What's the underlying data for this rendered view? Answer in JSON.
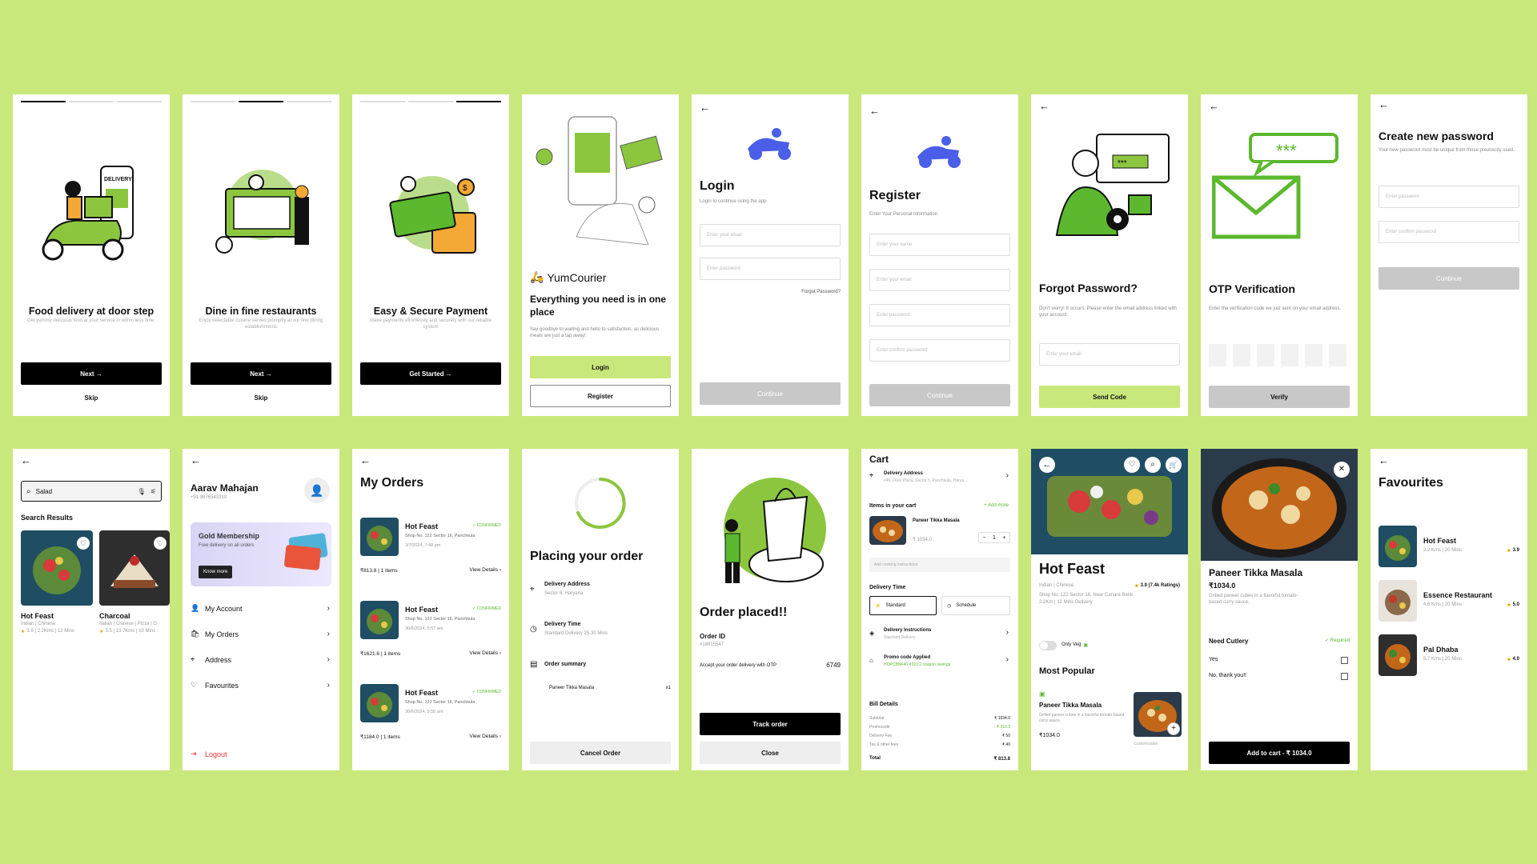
{
  "s1": {
    "title": "Food delivery at door step",
    "subtitle": "Get yummy delicious food at your service in within less time.",
    "btn": "Next →",
    "skip": "Skip",
    "delivery_sign": "DELIVERY"
  },
  "s2": {
    "title": "Dine in fine restaurants",
    "subtitle": "Enjoy delectable cuisine served promptly at our fine dining establishments",
    "btn": "Next →",
    "skip": "Skip"
  },
  "s3": {
    "title": "Easy & Secure Payment",
    "subtitle": "Make payments effortlessly and securely with our reliable system",
    "btn": "Get Started →"
  },
  "s4": {
    "brand": "YumCourier",
    "title": "Everything you need is in one place",
    "subtitle": "Say goodbye to waiting and hello to satisfaction, as delicious meals are just a tap away!",
    "login": "Login",
    "register": "Register"
  },
  "s5": {
    "title": "Login",
    "subtitle": "Login to continue using the app",
    "email_ph": "Enter your email",
    "pass_ph": "Enter password",
    "forgot": "Forgot Password?",
    "btn": "Continue"
  },
  "s6": {
    "title": "Register",
    "subtitle": "Enter Your Personal Information",
    "name_ph": "Enter your name",
    "email_ph": "Enter your email",
    "pass_ph": "Enter password",
    "confirm_ph": "Enter confirm password",
    "btn": "Continue"
  },
  "s7": {
    "title": "Forgot Password?",
    "subtitle": "Don't worry! It occurs. Please enter the email address linked with your account.",
    "email_ph": "Enter your email",
    "btn": "Send Code",
    "bubble_text": "***"
  },
  "s8": {
    "title": "OTP Verification",
    "subtitle": "Enter the verification code we just sent on your email address.",
    "btn": "Verify",
    "bubble_text": "***"
  },
  "s9": {
    "title": "Create new password",
    "subtitle": "Your new password must be unique from those previously used.",
    "pass_ph": "Enter password",
    "confirm_ph": "Enter confirm password",
    "btn": "Continue"
  },
  "s10": {
    "search_value": "Salad",
    "section": "Search Results",
    "results": [
      {
        "name": "Hot Feast",
        "meta": "Indian | Chinese",
        "rating": "3.9 | 2.2Kms | 12 Mins"
      },
      {
        "name": "Charcoal",
        "meta": "Italian | Chinese | Pizza | G",
        "rating": "3.5 | 13.7Kms | 10 Mins"
      }
    ]
  },
  "s11": {
    "name": "Aarav Mahajan",
    "phone": "+91 9876543210",
    "card_title": "Gold Membership",
    "card_sub": "Free delivery on all orders",
    "card_btn": "Know more",
    "menu": [
      "My Account",
      "My Orders",
      "Address",
      "Favourites"
    ],
    "logout": "Logout"
  },
  "s12": {
    "title": "My Orders",
    "orders": [
      {
        "name": "Hot Feast",
        "status": "CONFIRMED",
        "addr": "Shop No. 122 Sector 16, Panchkula",
        "date": "3/7/2024, 7:48 pm",
        "price": "₹813.8 | 1 items",
        "link": "View Details"
      },
      {
        "name": "Hot Feast",
        "status": "CONFIRMED",
        "addr": "Shop No. 122 Sector 16, Panchkula",
        "date": "30/6/2024, 5:57 am",
        "price": "₹1621.6 | 1 items",
        "link": "View Details"
      },
      {
        "name": "Hot Feast",
        "status": "CONFIRMED",
        "addr": "Shop No. 122 Sector 16, Panchkula",
        "date": "30/6/2024, 5:55 am",
        "price": "₹1184.0 | 1 items",
        "link": "View Details"
      }
    ]
  },
  "s13": {
    "title": "Placing your order",
    "addr_label": "Delivery Address",
    "addr_value": "Sector 6, Haryana",
    "time_label": "Delivery Time",
    "time_value": "Standard Delivery 25-30 Mins",
    "summary_label": "Order summary",
    "item": "Paneer Tikka Masala",
    "qty": "x1",
    "btn": "Cancel Order"
  },
  "s14": {
    "title": "Order placed!!",
    "id_label": "Order ID",
    "id_value": "#18915547",
    "otp_label": "Accept your order delivery with OTP",
    "otp_value": "6749",
    "track": "Track order",
    "close": "Close"
  },
  "s15": {
    "title": "Cart",
    "addr_label": "Delivery Address",
    "addr_value": "#46, Floor Plaza, Sector 5, Panchkula, Harya...",
    "items_label": "Items in your cart",
    "add_more": "+ Add more",
    "item_name": "Paneer Tikka Masala",
    "item_price": "₹ 1034.0",
    "qty": "1",
    "instr_ph": "Add cooking instructions",
    "time_label": "Delivery Time",
    "standard": "Standard",
    "schedule": "Schedule",
    "instr_label": "Delivery Instructions",
    "instr_value": "Standard Delivery",
    "promo_label": "Promo code Applied",
    "promo_value": "HOPCBNF40  ₹310.2 coupon savings",
    "bill_title": "Bill Details",
    "bill": [
      {
        "k": "Subtotal",
        "v": "₹ 1034.0"
      },
      {
        "k": "Promocode",
        "v": "- ₹ 310.2"
      },
      {
        "k": "Delivery Fee",
        "v": "₹ 50"
      },
      {
        "k": "Tax & other fees",
        "v": "₹ 40"
      }
    ],
    "total_k": "Total",
    "total_v": "₹ 813.8"
  },
  "s16": {
    "title": "Hot Feast",
    "cuisine": "Indian | Chinese",
    "rating": "3.9 (7.4k Ratings)",
    "addr": "Shop No. 122 Sector 16, Near Canara Bank",
    "dist": "2.2Km | 12 Mins Delivery",
    "veg": "Only Veg",
    "section": "Most Popular",
    "item_name": "Paneer Tikka Masala",
    "item_desc": "Grilled paneer cubes in a flavorful tomato-based curry sauce.",
    "item_price": "₹1034.0",
    "custom": "Customisable"
  },
  "s17": {
    "title": "Paneer Tikka Masala",
    "price": "₹1034.0",
    "desc": "Grilled paneer cubes in a flavorful tomato-based curry sauce.",
    "cutlery": "Need Cutlery",
    "required": "✓ Required",
    "opt1": "Yes",
    "opt2": "No, thank you!!",
    "btn": "Add to cart - ₹ 1034.0"
  },
  "s18": {
    "title": "Favourites",
    "items": [
      {
        "name": "Hot Feast",
        "meta": "2.2 Kms | 20 Mins",
        "rating": "3.9"
      },
      {
        "name": "Essence Restaurant",
        "meta": "4.6 Kms | 20 Mins",
        "rating": "5.0"
      },
      {
        "name": "Pal Dhaba",
        "meta": "5.7 Kms | 20 Mins",
        "rating": "4.0"
      }
    ]
  },
  "colors": {
    "bg": "#c8e87c",
    "accent": "#c8e87c",
    "brand_blue": "#4a5ee8",
    "confirm": "#5cb82e",
    "logout": "#e33333"
  }
}
